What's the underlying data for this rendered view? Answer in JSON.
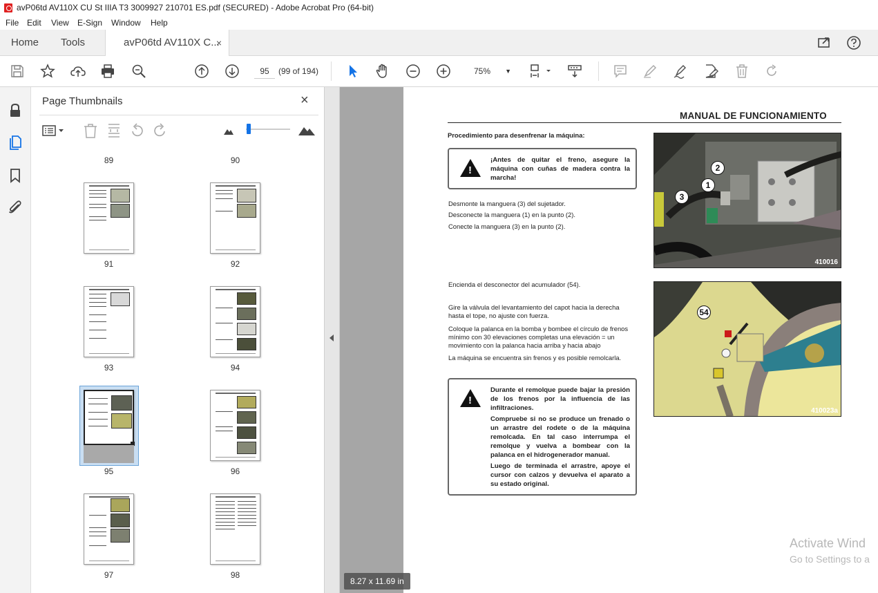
{
  "window": {
    "title": "avP06td AV110X CU St IIIA T3 3009927 210701 ES.pdf (SECURED) - Adobe Acrobat Pro (64-bit)"
  },
  "menu": [
    "File",
    "Edit",
    "View",
    "E-Sign",
    "Window",
    "Help"
  ],
  "tabs": {
    "home": "Home",
    "tools": "Tools",
    "document": "avP06td AV110X C...",
    "close": "×"
  },
  "toolbar": {
    "page_number": "95",
    "page_count": "(99 of 194)",
    "zoom": "75%"
  },
  "thumbnails": {
    "title": "Page Thumbnails",
    "close": "×",
    "top_labels": [
      "89",
      "90"
    ],
    "rows": [
      {
        "left": "91",
        "right": "92"
      },
      {
        "left": "93",
        "right": "94"
      },
      {
        "left": "95",
        "right": "96"
      },
      {
        "left": "97",
        "right": "98"
      }
    ],
    "selected_page": "95"
  },
  "document": {
    "heading": "MANUAL DE FUNCIONAMIENTO",
    "subheading": "Procedimiento para desenfrenar la máquina:",
    "warning1": "¡Antes de quitar el freno, asegure la máquina con cuñas de madera contra la marcha!",
    "steps1": [
      "Desmonte la manguera (3) del sujetador.",
      "Desconecte la manguera (1) en la punto (2).",
      "Conecte la manguera (3) en la punto (2)."
    ],
    "photo1_code": "410016",
    "photo1_callouts": [
      "1",
      "2",
      "3"
    ],
    "step2": "Encienda el desconector del acumulador (54).",
    "steps3": [
      "Gire la válvula del levantamiento del capot hacia la derecha hasta el tope, no ajuste con fuerza.",
      "Coloque la palanca en la bomba y bombee el círculo de frenos mínimo con 30 elevaciones completas una elevación = un movimiento con la palanca hacia arriba y hacia abajo",
      "La máquina se encuentra sin frenos y es posible remolcarla."
    ],
    "photo2_code": "410023a",
    "photo2_callout": "54",
    "warning2": [
      "Durante el remolque puede bajar la presión de los frenos por la influencia de las infiltraciones.",
      "Compruebe si no se produce un frenado o un arrastre del rodete o de la máquina remolcada. En tal caso interrumpa el remolque y vuelva a bombear con la palanca en el hidrogenerador manual.",
      "Luego de terminada el arrastre, apoye el cursor con calzos y devuelva el aparato a su estado original."
    ]
  },
  "status": {
    "page_size": "8.27 x 11.69 in"
  },
  "watermark": {
    "line1": "Activate Wind",
    "line2": "Go to Settings to a"
  },
  "colors": {
    "accent": "#1473e6",
    "app_icon": "#e02020",
    "selected_thumb": "#c9def2"
  }
}
